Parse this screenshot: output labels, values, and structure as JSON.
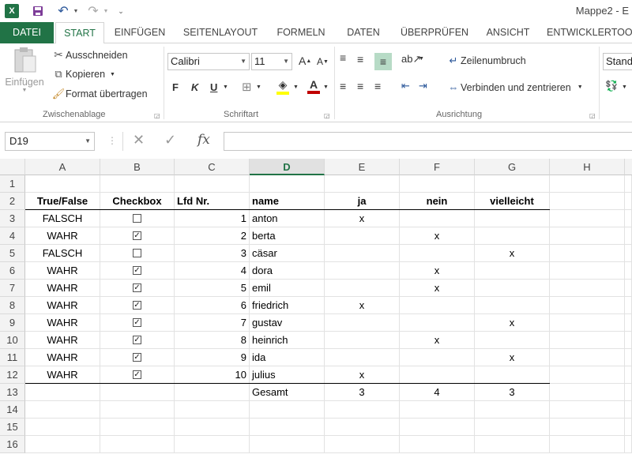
{
  "window": {
    "title": "Mappe2 - E"
  },
  "tabs": [
    "DATEI",
    "START",
    "EINFÜGEN",
    "SEITENLAYOUT",
    "FORMELN",
    "DATEN",
    "ÜBERPRÜFEN",
    "ANSICHT",
    "ENTWICKLERTOO"
  ],
  "ribbon": {
    "clipboard": {
      "paste": "Einfügen",
      "cut": "Ausschneiden",
      "copy": "Kopieren",
      "format_painter": "Format übertragen",
      "group": "Zwischenablage"
    },
    "font": {
      "name": "Calibri",
      "size": "11",
      "bold": "F",
      "italic": "K",
      "underline": "U",
      "group": "Schriftart"
    },
    "alignment": {
      "wrap": "Zeilenumbruch",
      "merge": "Verbinden und zentrieren",
      "group": "Ausrichtung"
    },
    "number": {
      "format": "Stand"
    }
  },
  "formula_bar": {
    "name_box": "D19",
    "fx": "fx",
    "value": ""
  },
  "columns": [
    "A",
    "B",
    "C",
    "D",
    "E",
    "F",
    "G",
    "H"
  ],
  "selected_column": "D",
  "rows": [
    "1",
    "2",
    "3",
    "4",
    "5",
    "6",
    "7",
    "8",
    "9",
    "10",
    "11",
    "12",
    "13",
    "14",
    "15",
    "16"
  ],
  "table": {
    "headers": {
      "a": "True/False",
      "b": "Checkbox",
      "c": "Lfd Nr.",
      "d": "name",
      "e": "ja",
      "f": "nein",
      "g": "vielleicht"
    },
    "records": [
      {
        "tf": "FALSCH",
        "checked": false,
        "nr": "1",
        "name": "anton",
        "ja": "x",
        "nein": "",
        "vielleicht": ""
      },
      {
        "tf": "WAHR",
        "checked": true,
        "nr": "2",
        "name": "berta",
        "ja": "",
        "nein": "x",
        "vielleicht": ""
      },
      {
        "tf": "FALSCH",
        "checked": false,
        "nr": "3",
        "name": "cäsar",
        "ja": "",
        "nein": "",
        "vielleicht": "x"
      },
      {
        "tf": "WAHR",
        "checked": true,
        "nr": "4",
        "name": "dora",
        "ja": "",
        "nein": "x",
        "vielleicht": ""
      },
      {
        "tf": "WAHR",
        "checked": true,
        "nr": "5",
        "name": "emil",
        "ja": "",
        "nein": "x",
        "vielleicht": ""
      },
      {
        "tf": "WAHR",
        "checked": true,
        "nr": "6",
        "name": "friedrich",
        "ja": "x",
        "nein": "",
        "vielleicht": ""
      },
      {
        "tf": "WAHR",
        "checked": true,
        "nr": "7",
        "name": "gustav",
        "ja": "",
        "nein": "",
        "vielleicht": "x"
      },
      {
        "tf": "WAHR",
        "checked": true,
        "nr": "8",
        "name": "heinrich",
        "ja": "",
        "nein": "x",
        "vielleicht": ""
      },
      {
        "tf": "WAHR",
        "checked": true,
        "nr": "9",
        "name": "ida",
        "ja": "",
        "nein": "",
        "vielleicht": "x"
      },
      {
        "tf": "WAHR",
        "checked": true,
        "nr": "10",
        "name": "julius",
        "ja": "x",
        "nein": "",
        "vielleicht": ""
      }
    ],
    "totals": {
      "label": "Gesamt",
      "ja": "3",
      "nein": "4",
      "vielleicht": "3"
    }
  },
  "colors": {
    "accent": "#217346",
    "selected_header": "#e1e1e1"
  }
}
